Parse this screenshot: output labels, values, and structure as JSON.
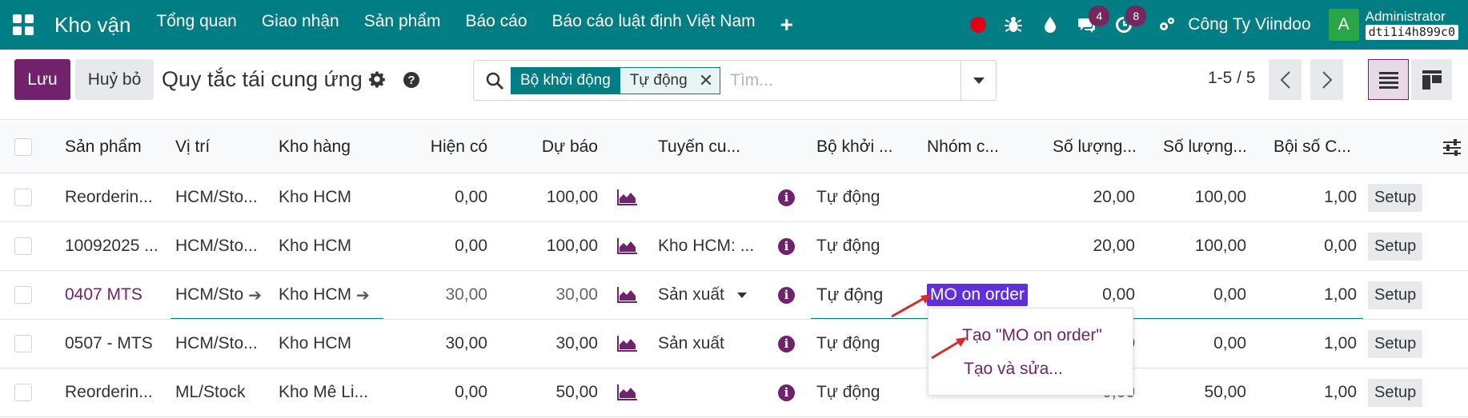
{
  "navbar": {
    "app_name": "Kho vận",
    "menu": [
      "Tổng quan",
      "Giao nhận",
      "Sản phẩm",
      "Báo cáo",
      "Báo cáo luật định Việt Nam"
    ],
    "plus_label": "+",
    "chat_badge": "4",
    "activity_badge": "8",
    "company": "Công Ty Viindoo",
    "avatar_letter": "A",
    "username": "Administrator",
    "database": "dti1i4h899c0"
  },
  "control": {
    "save_label": "Lưu",
    "discard_label": "Huỷ bỏ",
    "title": "Quy tắc tái cung ứng",
    "facet_label": "Bộ khởi động",
    "facet_value": "Tự động",
    "search_placeholder": "Tìm...",
    "pager": "1-5 / 5"
  },
  "table": {
    "headers": [
      "Sản phẩm",
      "Vị trí",
      "Kho hàng",
      "Hiện có",
      "Dự báo",
      "Tuyến cu...",
      "Bộ khởi ...",
      "Nhóm c...",
      "Số lượng...",
      "Số lượng...",
      "Bội số C..."
    ],
    "rows": [
      {
        "product": "Reorderin...",
        "location": "HCM/Sto...",
        "warehouse": "Kho HCM",
        "on_hand": "0,00",
        "forecast": "100,00",
        "route": "",
        "trigger": "Tự động",
        "group": "",
        "min": "20,00",
        "max": "100,00",
        "multiple": "1,00",
        "setup": "Setup"
      },
      {
        "product": "10092025 ...",
        "location": "HCM/Sto...",
        "warehouse": "Kho HCM",
        "on_hand": "0,00",
        "forecast": "100,00",
        "route": "Kho HCM: ...",
        "trigger": "Tự động",
        "group": "",
        "min": "20,00",
        "max": "100,00",
        "multiple": "0,00",
        "setup": "Setup"
      },
      {
        "product": "0407 MTS",
        "location": "HCM/Sto",
        "warehouse": "Kho HCM",
        "on_hand": "30,00",
        "forecast": "30,00",
        "route": "Sản xuất",
        "trigger": "Tự động",
        "group": "MO on order",
        "min": "0,00",
        "max": "0,00",
        "multiple": "1,00",
        "setup": "Setup"
      },
      {
        "product": "0507 - MTS",
        "location": "HCM/Sto...",
        "warehouse": "Kho HCM",
        "on_hand": "30,00",
        "forecast": "30,00",
        "route": "Sản xuất",
        "trigger": "Tự động",
        "group": "",
        "min": "",
        "max": "0,00",
        "multiple": "1,00",
        "setup": "Setup"
      },
      {
        "product": "Reorderin...",
        "location": "ML/Stock",
        "warehouse": "Kho Mê Li...",
        "on_hand": "0,00",
        "forecast": "50,00",
        "route": "",
        "trigger": "Tự động",
        "group": "",
        "min": "",
        "max": "50,00",
        "multiple": "1,00",
        "setup": "Setup"
      }
    ],
    "partial_min_row4": "0",
    "partial_min_row5": "0,00"
  },
  "dropdown": {
    "create": "Tạo \"MO on order\"",
    "create_edit": "Tạo và sửa..."
  },
  "colors": {
    "navbar": "#017e84",
    "primary": "#71226c",
    "tag": "#5f2fdb",
    "annotation": "#d62b2b"
  }
}
